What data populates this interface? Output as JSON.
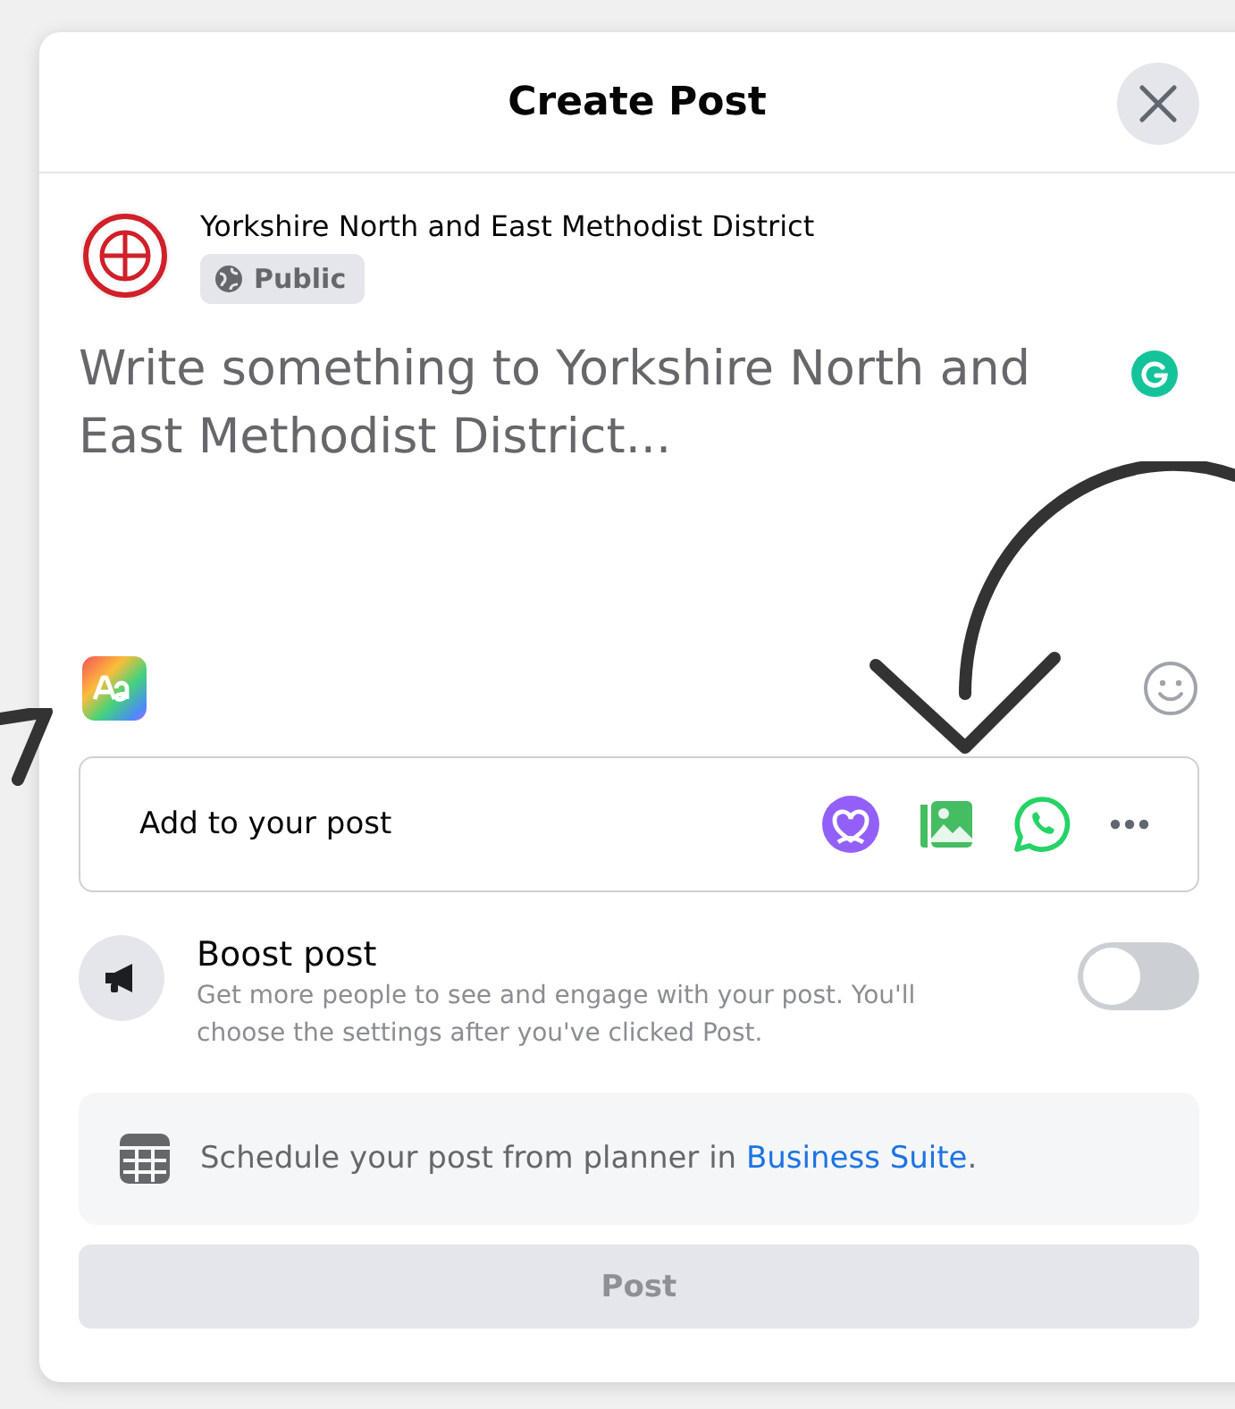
{
  "dialog": {
    "title": "Create Post"
  },
  "author": {
    "name": "Yorkshire North and East Methodist District",
    "audience": "Public"
  },
  "composer": {
    "placeholder": "Write something to Yorkshire North and East Methodist District..."
  },
  "add_to_post": {
    "label": "Add to your post"
  },
  "boost": {
    "title": "Boost post",
    "description": "Get more people to see and engage with your post. You'll choose the settings after you've clicked Post.",
    "on": false
  },
  "schedule": {
    "text": "Schedule your post from planner in ",
    "link": "Business Suite",
    "suffix": "."
  },
  "post_button": {
    "label": "Post",
    "disabled": true
  }
}
